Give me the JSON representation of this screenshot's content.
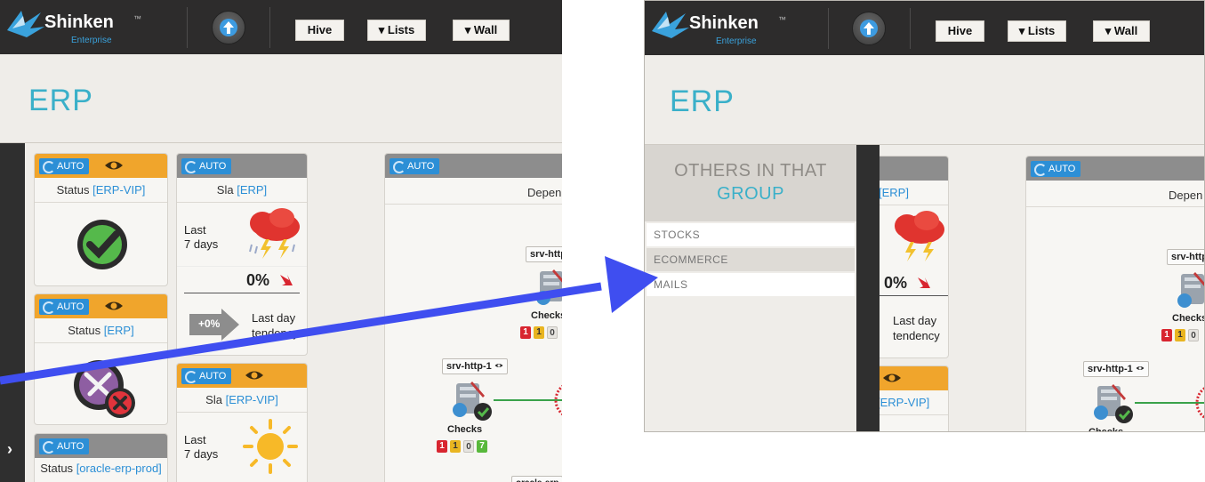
{
  "app": {
    "logo_text": "Shinken",
    "logo_tm": "™",
    "logo_sub": "Enterprise"
  },
  "nav": {
    "hive_label": "Hive",
    "lists_label": "▾ Lists",
    "wall_label": "▾ Wall"
  },
  "page": {
    "title": "ERP"
  },
  "widgets": {
    "auto_label": "AUTO",
    "status_label": "Status",
    "sla_label": "Sla",
    "dep_label": "Depen",
    "status_erp_vip": "[ERP-VIP]",
    "status_erp": "[ERP]",
    "status_oracle": "[oracle-erp-prod]",
    "sla_erp": "[ERP]",
    "sla_erp_vip": "[ERP-VIP]",
    "last_line1": "Last",
    "last_line2": "7 days",
    "sla_percent": "0%",
    "tendency_value": "+0%",
    "tendency_line1": "Last day",
    "tendency_line2": "tendency"
  },
  "dependencies": {
    "srv_top": "srv-http",
    "srv_main": "srv-http-1",
    "srv_bottom": "oracle-erp",
    "checks_label": "Checks",
    "counts": [
      "1",
      "1",
      "0",
      "7"
    ]
  },
  "others": {
    "title": "OTHERS IN THAT",
    "group": "GROUP",
    "items": [
      "STOCKS",
      "ECOMMERCE",
      "MAILS"
    ]
  },
  "colors": {
    "accent_teal": "#3ab0c9",
    "auto_blue": "#2c8fd6",
    "header_orange": "#f0a52c",
    "header_gray": "#8d8d8d",
    "topbar": "#2d2c2c",
    "annotation_arrow": "#3f4ef0"
  }
}
